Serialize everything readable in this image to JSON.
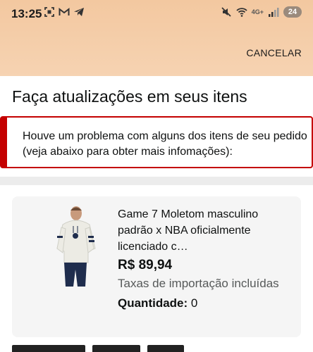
{
  "status_bar": {
    "time": "13:25",
    "left_icons": [
      "screenshot-icon",
      "gmail-icon",
      "telegram-icon"
    ],
    "right_icons": [
      "mute-icon",
      "wifi-icon",
      "signal-icon"
    ],
    "network": "4G+",
    "battery": "24"
  },
  "header": {
    "cancel_label": "CANCELAR"
  },
  "page": {
    "title": "Faça atualizações em seus itens"
  },
  "alert": {
    "message": "Houve um problema com alguns dos itens de seu pedido (veja abaixo para obter mais infomações):",
    "color": "#c40000"
  },
  "item": {
    "title": "Game 7 Moletom masculino padrão x NBA oficialmente licenciado c…",
    "price": "R$ 89,94",
    "fees": "Taxas de importação incluídas",
    "quantity_label": "Quantidade:",
    "quantity_value": "0"
  },
  "colors": {
    "header_bg": "#f3c8a0",
    "alert_border": "#c40000",
    "card_bg": "#f5f5f5"
  }
}
